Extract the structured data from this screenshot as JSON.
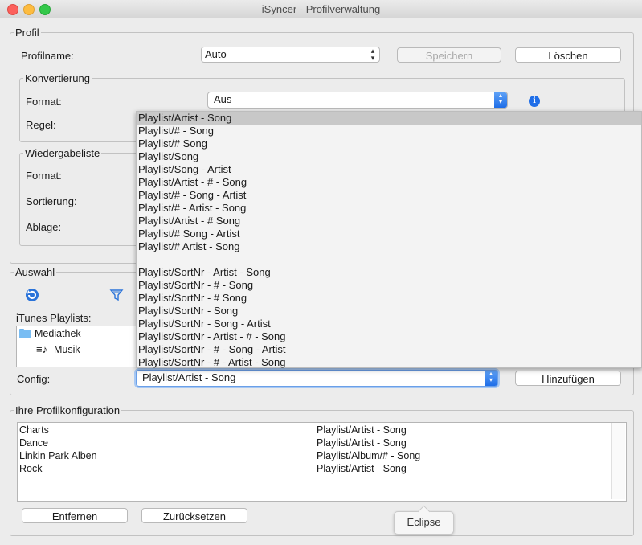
{
  "window": {
    "title": "iSyncer - Profilverwaltung"
  },
  "profil": {
    "legend": "Profil",
    "name_label": "Profilname:",
    "name_value": "Auto",
    "save_label": "Speichern",
    "delete_label": "Löschen"
  },
  "konvertierung": {
    "legend": "Konvertierung",
    "format_label": "Format:",
    "format_value": "Aus",
    "rule_label": "Regel:"
  },
  "wiedergabeliste": {
    "legend": "Wiedergabeliste",
    "format_label": "Format:",
    "sort_label": "Sortierung:",
    "storage_label": "Ablage:"
  },
  "auswahl": {
    "legend": "Auswahl",
    "playlists_label": "iTunes Playlists:",
    "tree": [
      "Mediathek",
      "Musik"
    ],
    "config_label": "Config:",
    "config_value": "Playlist/Artist - Song",
    "add_label": "Hinzufügen"
  },
  "dropdown": {
    "group1": [
      "Playlist/Artist - Song",
      "Playlist/# - Song",
      "Playlist/# Song",
      "Playlist/Song",
      "Playlist/Song - Artist",
      "Playlist/Artist - # - Song",
      "Playlist/# - Song - Artist",
      "Playlist/# - Artist - Song",
      "Playlist/Artist - # Song",
      "Playlist/# Song - Artist",
      "Playlist/# Artist - Song"
    ],
    "group2": [
      "Playlist/SortNr - Artist - Song",
      "Playlist/SortNr - # - Song",
      "Playlist/SortNr - # Song",
      "Playlist/SortNr - Song",
      "Playlist/SortNr - Song - Artist",
      "Playlist/SortNr - Artist - # - Song",
      "Playlist/SortNr - # - Song - Artist",
      "Playlist/SortNr - # - Artist - Song"
    ]
  },
  "konfiguration": {
    "legend": "Ihre Profilkonfiguration",
    "rows": [
      {
        "name": "Charts",
        "config": "Playlist/Artist - Song"
      },
      {
        "name": "Dance",
        "config": "Playlist/Artist - Song"
      },
      {
        "name": "Linkin Park Alben",
        "config": "Playlist/Album/# - Song"
      },
      {
        "name": "Rock",
        "config": "Playlist/Artist - Song"
      }
    ],
    "remove_label": "Entfernen",
    "reset_label": "Zurücksetzen"
  },
  "tooltip": {
    "text": "Eclipse"
  },
  "colors": {
    "close": "#fc605c",
    "minimize": "#fdbc40",
    "zoom": "#34c84a",
    "accent": "#2a7be8"
  }
}
